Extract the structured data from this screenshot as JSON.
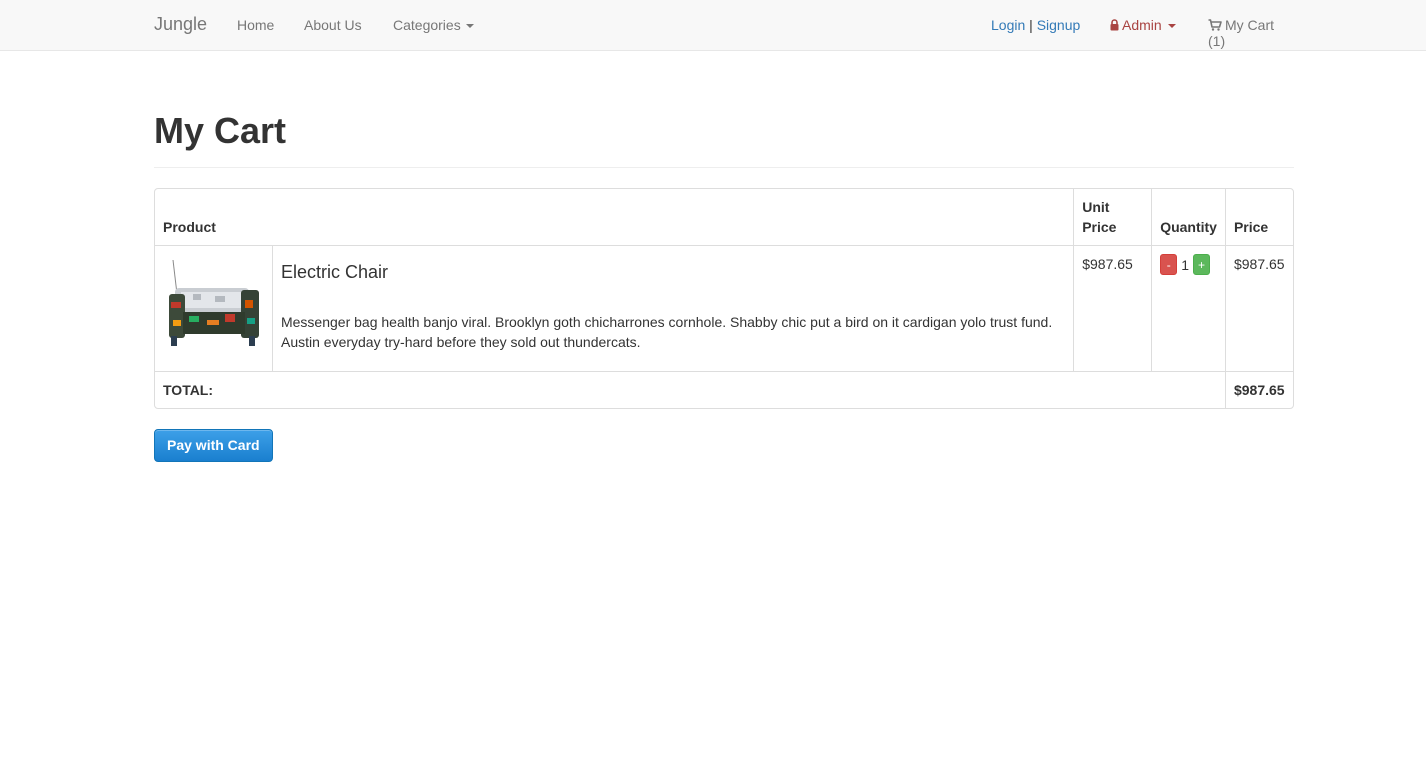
{
  "navbar": {
    "brand": "Jungle",
    "links": [
      "Home",
      "About Us"
    ],
    "categories_label": "Categories",
    "login_label": "Login",
    "separator": "|",
    "signup_label": "Signup",
    "admin_label": "Admin",
    "cart_label": "My Cart (1)"
  },
  "page": {
    "title": "My Cart"
  },
  "cart": {
    "headers": {
      "product": "Product",
      "unit_price": "Unit Price",
      "quantity": "Quantity",
      "price": "Price"
    },
    "items": [
      {
        "name": "Electric Chair",
        "description": "Messenger bag health banjo viral. Brooklyn goth chicharrones cornhole. Shabby chic put a bird on it cardigan yolo trust fund. Austin everyday try-hard before they sold out thundercats.",
        "unit_price": "$987.65",
        "quantity": "1",
        "price": "$987.65",
        "decrement_label": "-",
        "increment_label": "+"
      }
    ],
    "total_label": "TOTAL:",
    "total_value": "$987.65"
  },
  "pay_button_label": "Pay with Card",
  "colors": {
    "link": "#337ab7",
    "admin": "#a94442",
    "decrement": "#d9534f",
    "increment": "#5cb85c",
    "pay_button": "#1a7fcf"
  },
  "icons": [
    "lock-icon",
    "cart-icon",
    "caret-down-icon"
  ]
}
